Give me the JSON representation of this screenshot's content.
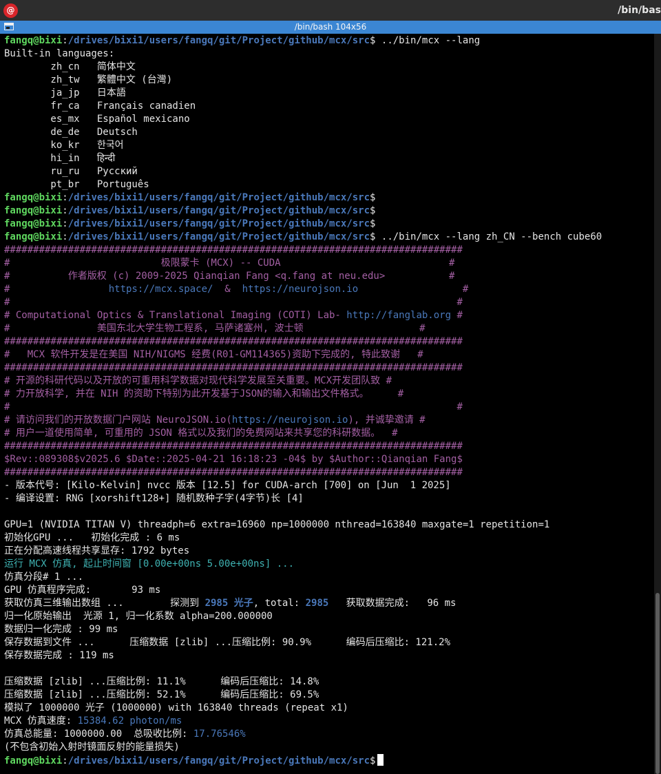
{
  "topbar": {
    "app_icon": "debian-swirl-icon",
    "title": "/bin/bas"
  },
  "window": {
    "title": "/bin/bash 104x56"
  },
  "terminal": {
    "lines": [
      [
        {
          "t": "fangq@bixi",
          "c": "bg"
        },
        {
          "t": ":",
          "c": "w"
        },
        {
          "t": "/drives/bixi1/users/fangq/git/Project/github/mcx/src",
          "c": "bb"
        },
        {
          "t": "$ ../bin/mcx --lang",
          "c": "w"
        }
      ],
      [
        {
          "t": "Built-in languages:",
          "c": "w"
        }
      ],
      [
        {
          "t": "        zh_cn   简体中文",
          "c": "w"
        }
      ],
      [
        {
          "t": "        zh_tw   繁體中文 (台灣)",
          "c": "w"
        }
      ],
      [
        {
          "t": "        ja_jp   日本語",
          "c": "w"
        }
      ],
      [
        {
          "t": "        fr_ca   Français canadien",
          "c": "w"
        }
      ],
      [
        {
          "t": "        es_mx   Español mexicano",
          "c": "w"
        }
      ],
      [
        {
          "t": "        de_de   Deutsch",
          "c": "w"
        }
      ],
      [
        {
          "t": "        ko_kr   한국어",
          "c": "w"
        }
      ],
      [
        {
          "t": "        hi_in   हिन्दी",
          "c": "w"
        }
      ],
      [
        {
          "t": "        ru_ru   Русский",
          "c": "w"
        }
      ],
      [
        {
          "t": "        pt_br   Português",
          "c": "w"
        }
      ],
      [
        {
          "t": "fangq@bixi",
          "c": "bg"
        },
        {
          "t": ":",
          "c": "w"
        },
        {
          "t": "/drives/bixi1/users/fangq/git/Project/github/mcx/src",
          "c": "bb"
        },
        {
          "t": "$",
          "c": "w"
        }
      ],
      [
        {
          "t": "fangq@bixi",
          "c": "bg"
        },
        {
          "t": ":",
          "c": "w"
        },
        {
          "t": "/drives/bixi1/users/fangq/git/Project/github/mcx/src",
          "c": "bb"
        },
        {
          "t": "$",
          "c": "w"
        }
      ],
      [
        {
          "t": "fangq@bixi",
          "c": "bg"
        },
        {
          "t": ":",
          "c": "w"
        },
        {
          "t": "/drives/bixi1/users/fangq/git/Project/github/mcx/src",
          "c": "bb"
        },
        {
          "t": "$",
          "c": "w"
        }
      ],
      [
        {
          "t": "fangq@bixi",
          "c": "bg"
        },
        {
          "t": ":",
          "c": "w"
        },
        {
          "t": "/drives/bixi1/users/fangq/git/Project/github/mcx/src",
          "c": "bb"
        },
        {
          "t": "$ ../bin/mcx --lang zh_CN --bench cube60",
          "c": "w"
        }
      ],
      [
        {
          "t": "###############################################################################",
          "c": "pu"
        }
      ],
      [
        {
          "t": "#                          极限蒙卡 (MCX) -- CUDA                             #",
          "c": "pu"
        }
      ],
      [
        {
          "t": "#          作者版权 (c) 2009-2025 Qianqian Fang <q.fang at neu.edu>           #",
          "c": "pu"
        }
      ],
      [
        {
          "t": "#                 ",
          "c": "pu"
        },
        {
          "t": "https://mcx.space/",
          "c": "bl"
        },
        {
          "t": "  &  ",
          "c": "pu"
        },
        {
          "t": "https://neurojson.io",
          "c": "bl"
        },
        {
          "t": "                  #",
          "c": "pu"
        }
      ],
      [
        {
          "t": "#                                                                             #",
          "c": "pu"
        }
      ],
      [
        {
          "t": "# Computational Optics & Translational Imaging (COTI) Lab- ",
          "c": "pu"
        },
        {
          "t": "http://fanglab.org",
          "c": "bl"
        },
        {
          "t": " #",
          "c": "pu"
        }
      ],
      [
        {
          "t": "#               美国东北大学生物工程系, 马萨诸塞州, 波士顿                    #",
          "c": "pu"
        }
      ],
      [
        {
          "t": "###############################################################################",
          "c": "pu"
        }
      ],
      [
        {
          "t": "#   MCX 软件开发是在美国 NIH/NIGMS 经费(R01-GM114365)资助下完成的, 特此致谢   #",
          "c": "pu"
        }
      ],
      [
        {
          "t": "###############################################################################",
          "c": "pu"
        }
      ],
      [
        {
          "t": "# 开源的科研代码以及开放的可重用科学数据对现代科学发展至关重要。MCX开发团队致 #",
          "c": "pu"
        }
      ],
      [
        {
          "t": "# 力开放科学, 并在 NIH 的资助下特别为此开发基于JSON的输入和输出文件格式。     #",
          "c": "pu"
        }
      ],
      [
        {
          "t": "#                                                                             #",
          "c": "pu"
        }
      ],
      [
        {
          "t": "# 请访问我们的开放数据门户网站 NeuroJSON.io(",
          "c": "pu"
        },
        {
          "t": "https://neurojson.io",
          "c": "bl"
        },
        {
          "t": "), 并诚挚邀请 #",
          "c": "pu"
        }
      ],
      [
        {
          "t": "# 用户一道使用简单, 可重用的 JSON 格式以及我们的免费网站来共享您的科研数据。  #",
          "c": "pu"
        }
      ],
      [
        {
          "t": "###############################################################################",
          "c": "pu"
        }
      ],
      [
        {
          "t": "$Rev::089308$v2025.6 $Date::2025-04-21 16:18:23 -04$ by $Author::Qianqian Fang$",
          "c": "pu"
        }
      ],
      [
        {
          "t": "###############################################################################",
          "c": "pu"
        }
      ],
      [
        {
          "t": "- 版本代号: [Kilo-Kelvin] nvcc 版本 [12.5] for CUDA-arch [700] on [Jun  1 2025]",
          "c": "w"
        }
      ],
      [
        {
          "t": "- 编译设置: RNG [xorshift128+] 随机数种子字(4字节)长 [4]",
          "c": "w"
        }
      ],
      [
        {
          "t": "",
          "c": "w"
        }
      ],
      [
        {
          "t": "GPU=1 (NVIDIA TITAN V) threadph=6 extra=16960 np=1000000 nthread=163840 maxgate=1 repetition=1",
          "c": "w"
        }
      ],
      [
        {
          "t": "初始化GPU ...   初始化完成 : 6 ms",
          "c": "w"
        }
      ],
      [
        {
          "t": "正在分配高速线程共享显存: 1792 bytes",
          "c": "w"
        }
      ],
      [
        {
          "t": "运行 MCX 仿真, 起止时间窗 [0.00e+00ns 5.00e+00ns] ...",
          "c": "cy"
        }
      ],
      [
        {
          "t": "仿真分段# 1 ...",
          "c": "w"
        }
      ],
      [
        {
          "t": "GPU 仿真程序完成:       93 ms",
          "c": "w"
        }
      ],
      [
        {
          "t": "获取仿真三维输出数组 ...        探测到 ",
          "c": "w"
        },
        {
          "t": "2985 光子",
          "c": "bld"
        },
        {
          "t": ", total: ",
          "c": "w"
        },
        {
          "t": "2985",
          "c": "bld"
        },
        {
          "t": "   获取数据完成:   96 ms",
          "c": "w"
        }
      ],
      [
        {
          "t": "归一化原始输出  光源 1, 归一化系数 alpha=200.000000",
          "c": "w"
        }
      ],
      [
        {
          "t": "数据归一化完成 : 99 ms",
          "c": "w"
        }
      ],
      [
        {
          "t": "保存数据到文件 ...      压缩数据 [zlib] ...压缩比例: 90.9%      编码后压缩比: 121.2%",
          "c": "w"
        }
      ],
      [
        {
          "t": "保存数据完成 : 119 ms",
          "c": "w"
        }
      ],
      [
        {
          "t": "",
          "c": "w"
        }
      ],
      [
        {
          "t": "压缩数据 [zlib] ...压缩比例: 11.1%      编码后压缩比: 14.8%",
          "c": "w"
        }
      ],
      [
        {
          "t": "压缩数据 [zlib] ...压缩比例: 52.1%      编码后压缩比: 69.5%",
          "c": "w"
        }
      ],
      [
        {
          "t": "模拟了 1000000 光子 (1000000) with 163840 threads (repeat x1)",
          "c": "w"
        }
      ],
      [
        {
          "t": "MCX 仿真速度: ",
          "c": "w"
        },
        {
          "t": "15384.62 photon/ms",
          "c": "bl"
        }
      ],
      [
        {
          "t": "仿真总能量: 1000000.00  总吸收比例: ",
          "c": "w"
        },
        {
          "t": "17.76546%",
          "c": "bl"
        }
      ],
      [
        {
          "t": "(不包含初始入射时镜面反射的能量损失)",
          "c": "w"
        }
      ],
      [
        {
          "t": "fangq@bixi",
          "c": "bg"
        },
        {
          "t": ":",
          "c": "w"
        },
        {
          "t": "/drives/bixi1/users/fangq/git/Project/github/mcx/src",
          "c": "bb"
        },
        {
          "t": "$",
          "c": "w"
        }
      ]
    ]
  }
}
